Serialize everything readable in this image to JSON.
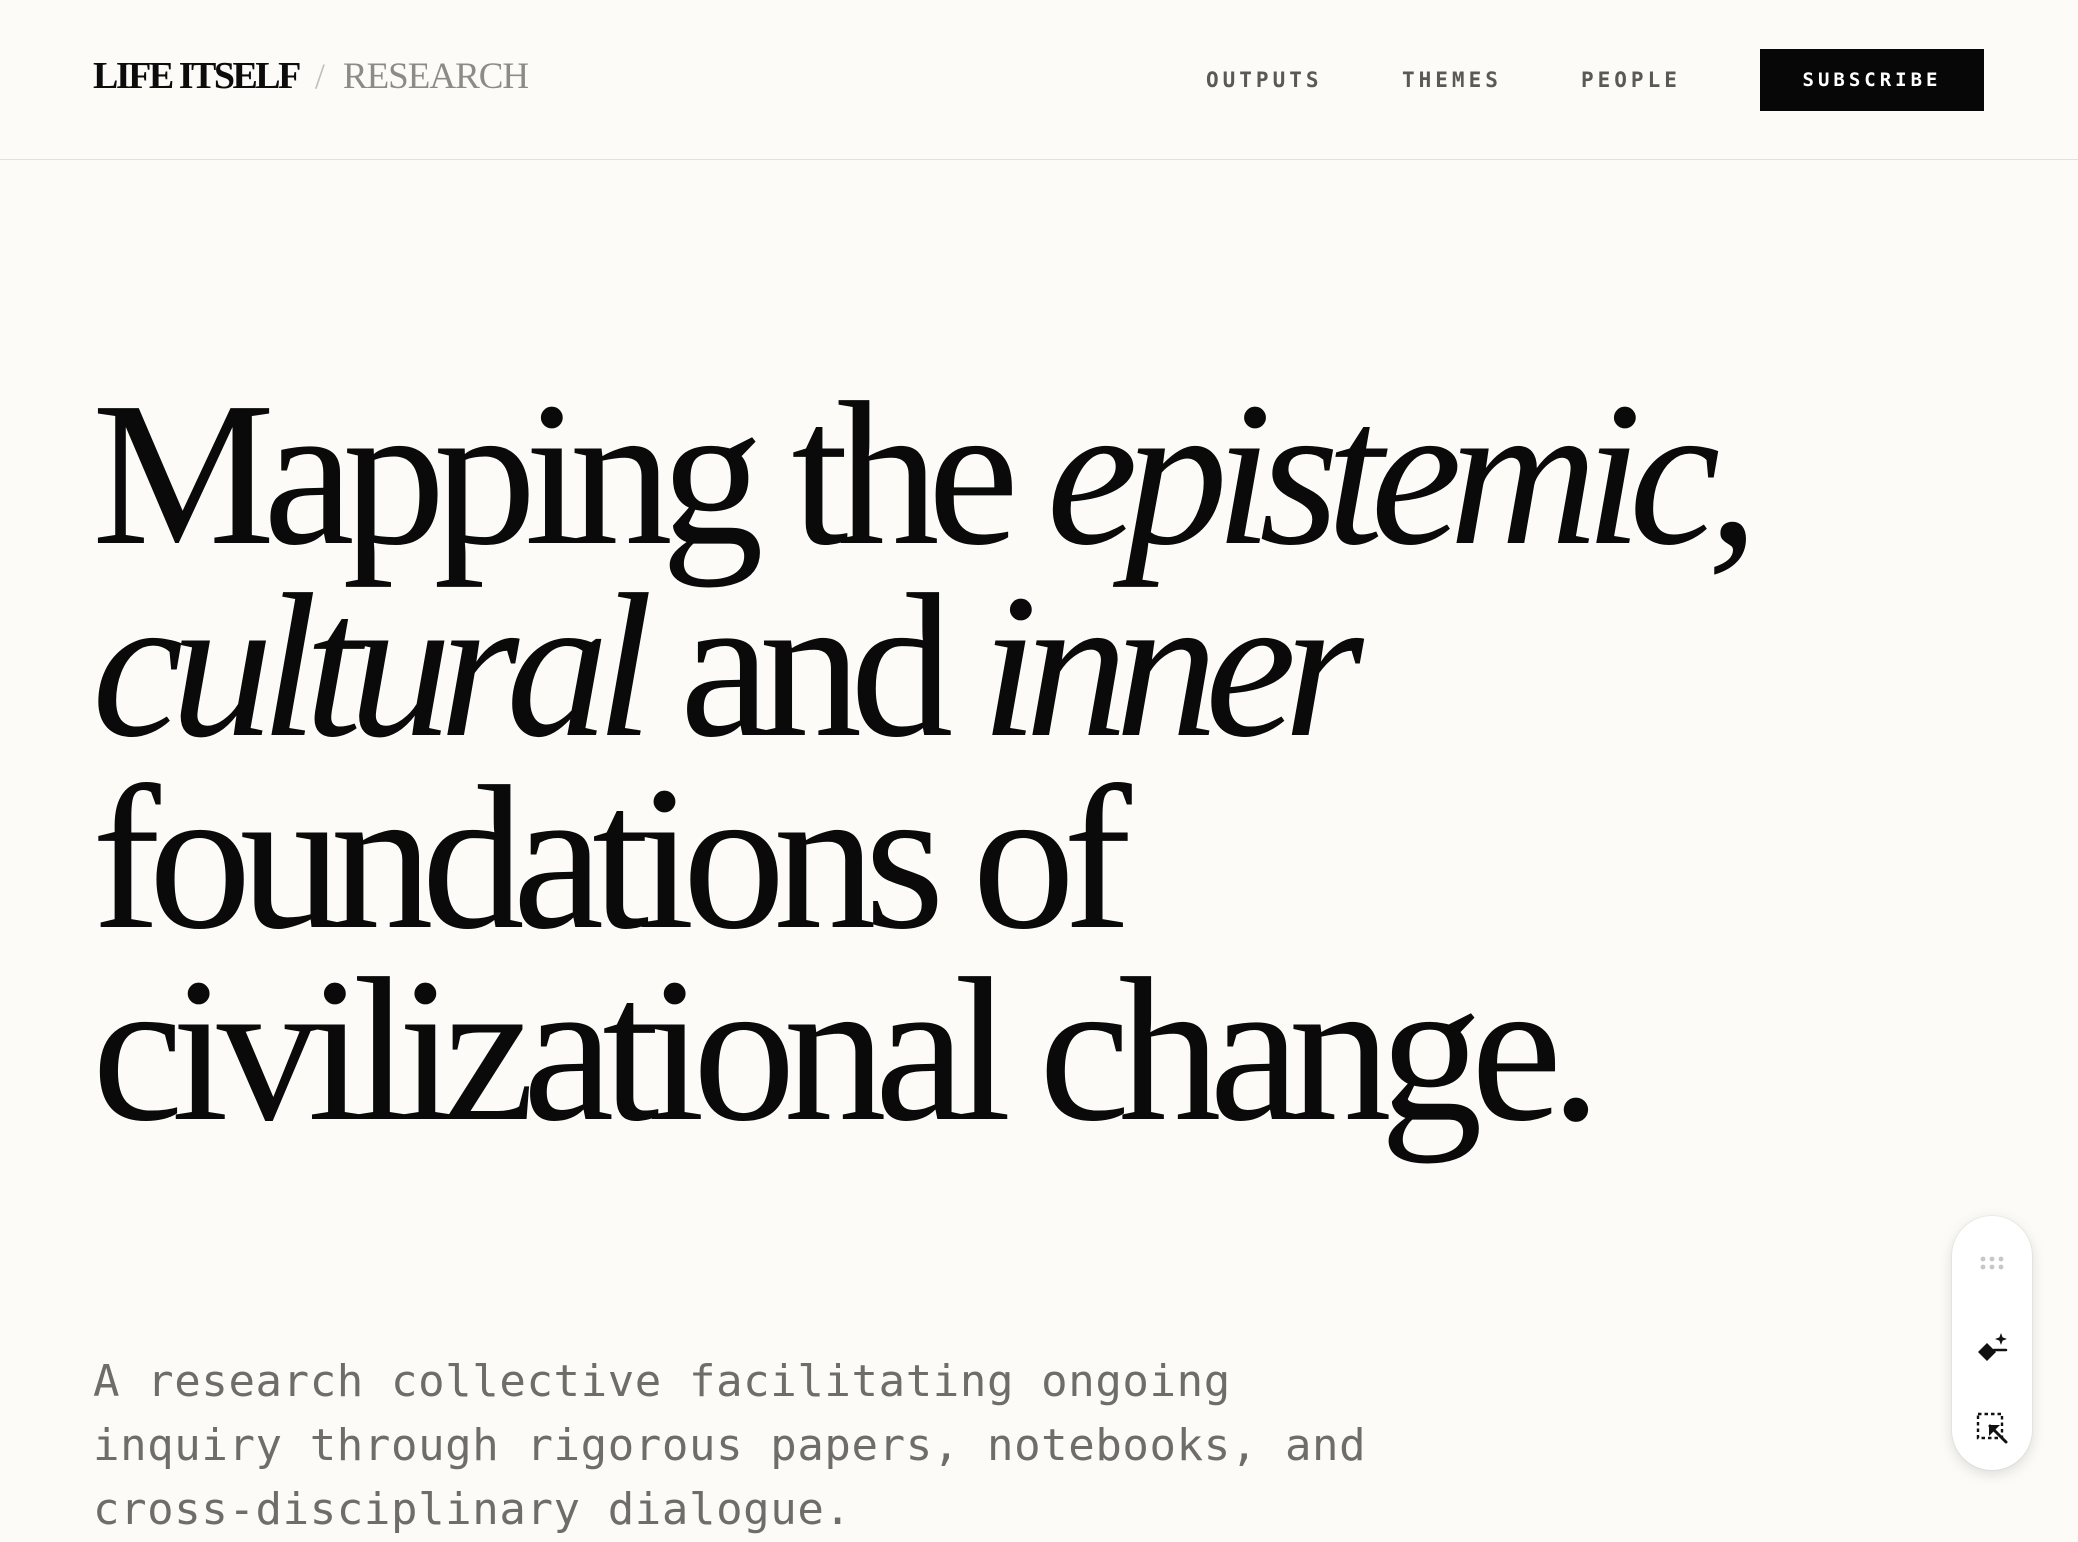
{
  "header": {
    "brand_name": "LIFE ITSELF",
    "brand_separator": "/",
    "brand_section": "RESEARCH",
    "nav": [
      "OUTPUTS",
      "THEMES",
      "PEOPLE"
    ],
    "subscribe_label": "SUBSCRIBE"
  },
  "hero": {
    "title": {
      "line1_a": "Mapping the ",
      "line1_b": "epistemic,",
      "line2_a": "cultural",
      "line2_b": " and ",
      "line2_c": "inner",
      "line3": "foundations of",
      "line4": "civilizational change."
    },
    "subtitle_lines": [
      "A research collective facilitating ongoing",
      "inquiry through rigorous papers, notebooks, and",
      "cross-disciplinary dialogue."
    ]
  },
  "toolbar": {
    "icons": [
      "drag-handle-icon",
      "sparkle-eraser-icon",
      "select-cursor-icon"
    ]
  },
  "colors": {
    "background": "#fcfbf8",
    "text": "#0c0c0c",
    "muted": "#6f6d69",
    "button_bg": "#070707"
  }
}
